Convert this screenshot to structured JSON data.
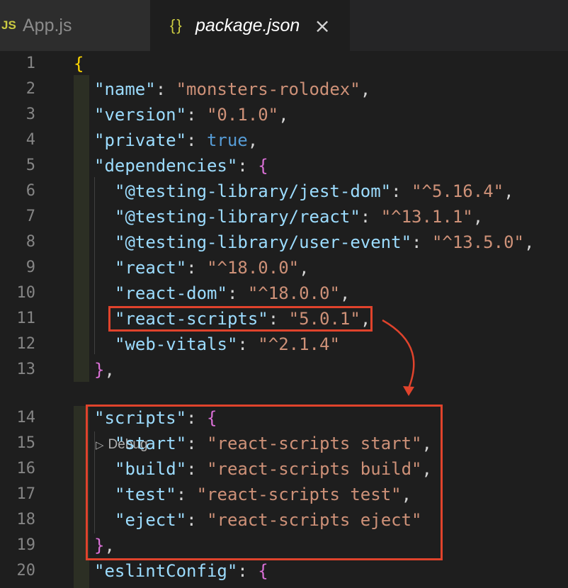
{
  "tabs": [
    {
      "icon": "js-icon",
      "icon_text": "JS",
      "label": "App.js"
    },
    {
      "icon": "braces-icon",
      "icon_text": "{}",
      "label": "package.json",
      "close": "×"
    }
  ],
  "codelens": {
    "label": "Debug"
  },
  "lines": [
    {
      "n": "1"
    },
    {
      "n": "2"
    },
    {
      "n": "3"
    },
    {
      "n": "4"
    },
    {
      "n": "5"
    },
    {
      "n": "6"
    },
    {
      "n": "7"
    },
    {
      "n": "8"
    },
    {
      "n": "9"
    },
    {
      "n": "10"
    },
    {
      "n": "11"
    },
    {
      "n": "12"
    },
    {
      "n": "13"
    },
    {
      "n": "14"
    },
    {
      "n": "15"
    },
    {
      "n": "16"
    },
    {
      "n": "17"
    },
    {
      "n": "18"
    },
    {
      "n": "19"
    },
    {
      "n": "20"
    }
  ],
  "code": {
    "open_brace": "{",
    "name_key": "\"name\"",
    "name_val": "\"monsters-rolodex\"",
    "version_key": "\"version\"",
    "version_val": "\"0.1.0\"",
    "private_key": "\"private\"",
    "private_val": "true",
    "deps_key": "\"dependencies\"",
    "dep1_key": "\"@testing-library/jest-dom\"",
    "dep1_val": "\"^5.16.4\"",
    "dep2_key": "\"@testing-library/react\"",
    "dep2_val": "\"^13.1.1\"",
    "dep3_key": "\"@testing-library/user-event\"",
    "dep3_val": "\"^13.5.0\"",
    "dep4_key": "\"react\"",
    "dep4_val": "\"^18.0.0\"",
    "dep5_key": "\"react-dom\"",
    "dep5_val": "\"^18.0.0\"",
    "dep6_key": "\"react-scripts\"",
    "dep6_val": "\"5.0.1\"",
    "dep7_key": "\"web-vitals\"",
    "dep7_val": "\"^2.1.4\"",
    "scripts_key": "\"scripts\"",
    "s1_key": "\"start\"",
    "s1_val": "\"react-scripts start\"",
    "s2_key": "\"build\"",
    "s2_val": "\"react-scripts build\"",
    "s3_key": "\"test\"",
    "s3_val": "\"react-scripts test\"",
    "s4_key": "\"eject\"",
    "s4_val": "\"react-scripts eject\"",
    "eslint_key": "\"eslintConfig\""
  },
  "colors": {
    "highlight": "#e0432c",
    "key": "#9cdcfe",
    "string": "#ce9178",
    "keyword": "#569cd6"
  }
}
